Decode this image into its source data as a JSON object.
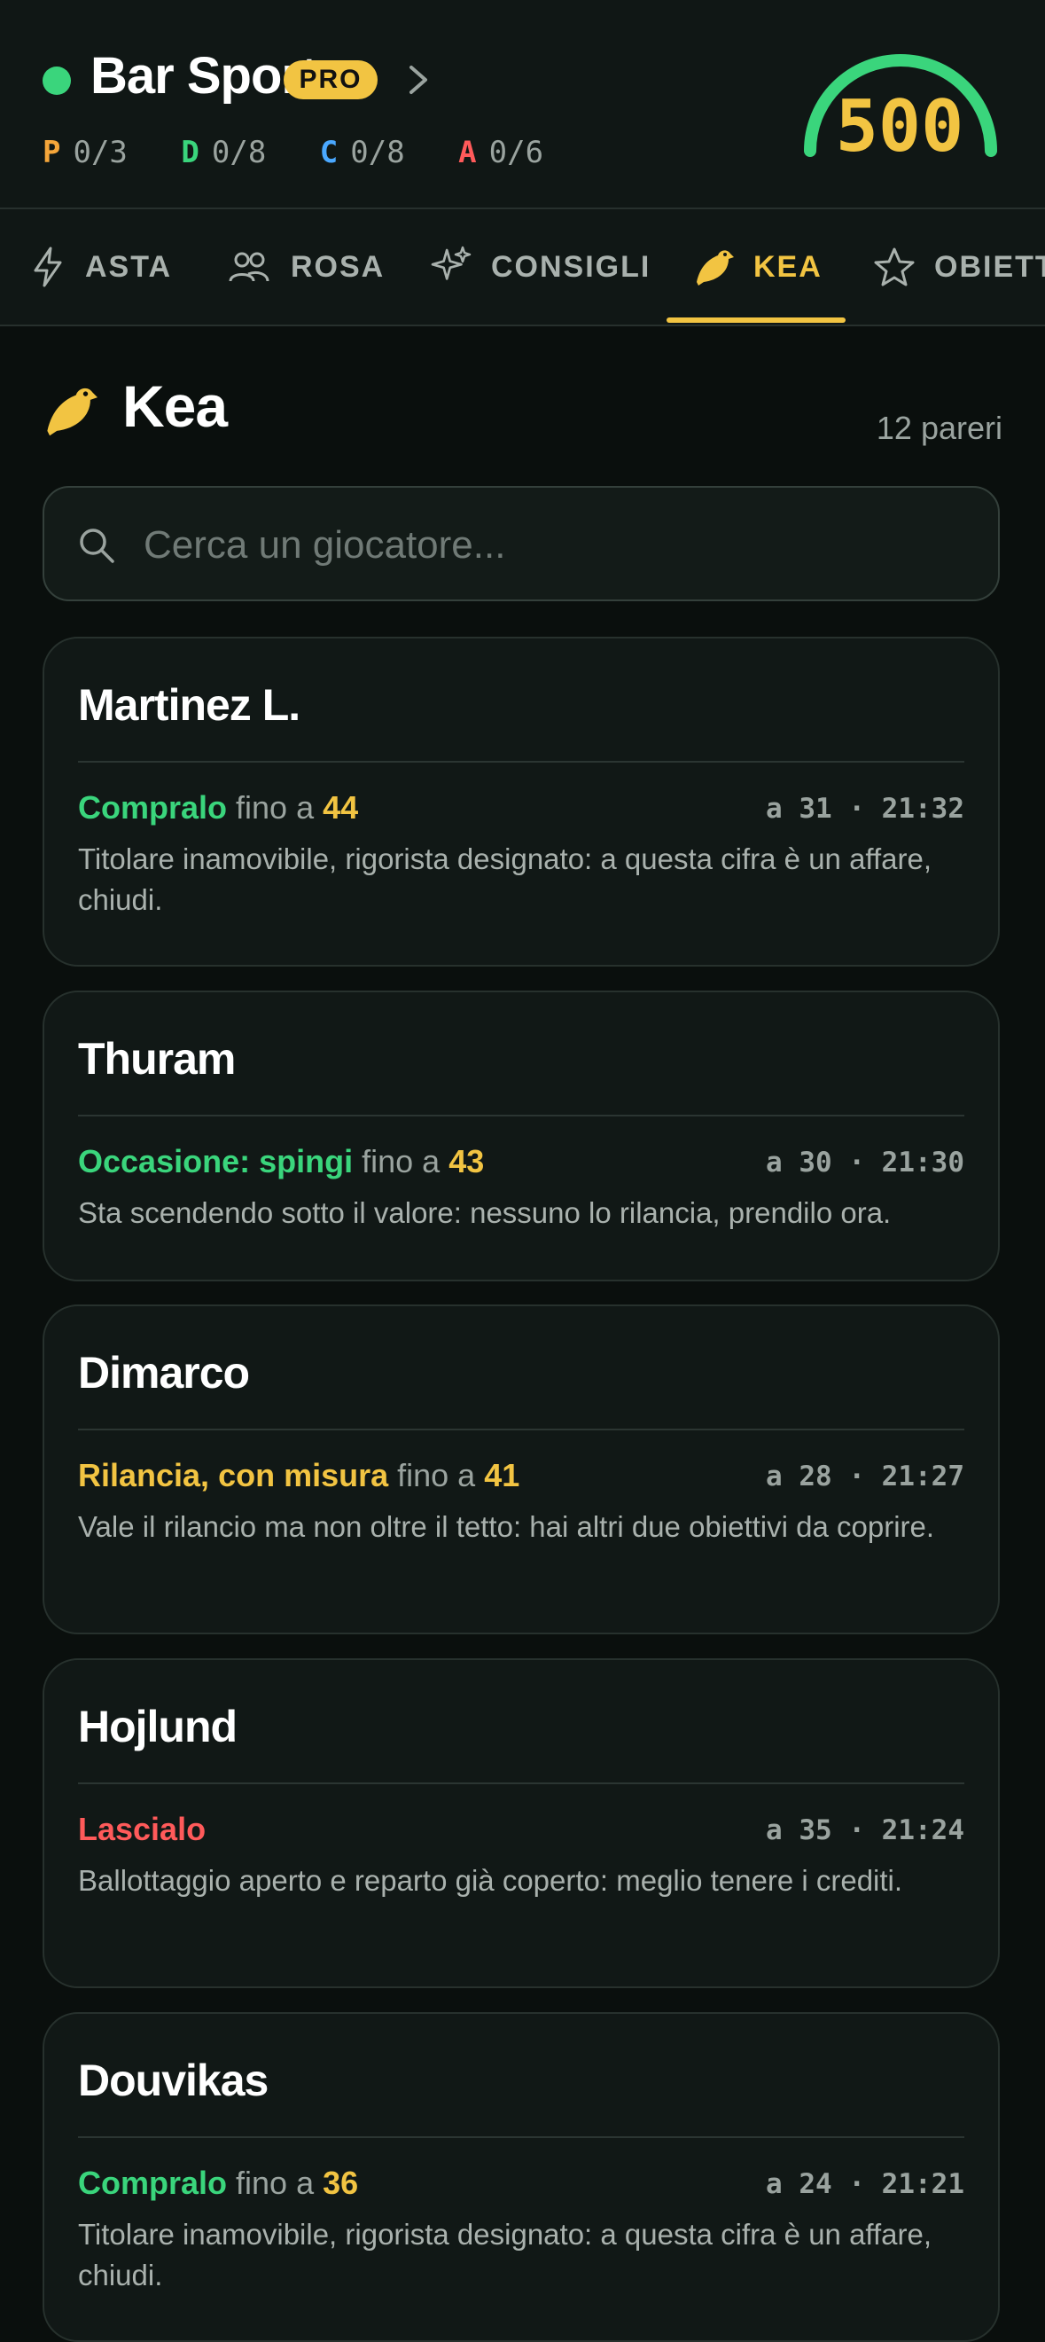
{
  "header": {
    "league_name": "Bar Sport",
    "badge": "PRO",
    "credits": "500",
    "quotas": [
      {
        "role": "P",
        "value": "0/3",
        "color": "#f5a63a"
      },
      {
        "role": "D",
        "value": "0/8",
        "color": "#3ad57c"
      },
      {
        "role": "C",
        "value": "0/8",
        "color": "#4aa8ff"
      },
      {
        "role": "A",
        "value": "0/6",
        "color": "#ff5a5a"
      }
    ]
  },
  "tabs": [
    {
      "label": "ASTA",
      "icon": "bolt-icon"
    },
    {
      "label": "ROSA",
      "icon": "users-icon"
    },
    {
      "label": "CONSIGLI",
      "icon": "sparkles-icon"
    },
    {
      "label": "KEA",
      "icon": "bird-icon",
      "active": true
    },
    {
      "label": "OBIETTIVI",
      "icon": "star-icon"
    }
  ],
  "section": {
    "title": "Kea",
    "count": "12 pareri"
  },
  "search": {
    "placeholder": "Cerca un giocatore..."
  },
  "cards": [
    {
      "name": "Martinez L.",
      "verdict": "Compralo",
      "verdict_color": "#3ad57c",
      "fino": "fino a",
      "limit": "44",
      "meta": "a 31 · 21:32",
      "note": "Titolare inamovibile, rigorista designato: a questa cifra è un affare, chiudi."
    },
    {
      "name": "Thuram",
      "verdict": "Occasione: spingi",
      "verdict_color": "#3ad57c",
      "fino": "fino a",
      "limit": "43",
      "meta": "a 30 · 21:30",
      "note": "Sta scendendo sotto il valore: nessuno lo rilancia, prendilo ora."
    },
    {
      "name": "Dimarco",
      "verdict": "Rilancia, con misura",
      "verdict_color": "#f2c442",
      "fino": "fino a",
      "limit": "41",
      "meta": "a 28 · 21:27",
      "note": "Vale il rilancio ma non oltre il tetto: hai altri due obiettivi da coprire."
    },
    {
      "name": "Hojlund",
      "verdict": "Lascialo",
      "verdict_color": "#ff5a5a",
      "fino": "",
      "limit": "",
      "meta": "a 35 · 21:24",
      "note": "Ballottaggio aperto e reparto già coperto: meglio tenere i crediti."
    },
    {
      "name": "Douvikas",
      "verdict": "Compralo",
      "verdict_color": "#3ad57c",
      "fino": "fino a",
      "limit": "36",
      "meta": "a 24 · 21:21",
      "note": "Titolare inamovibile, rigorista designato: a questa cifra è un affare, chiudi."
    }
  ]
}
